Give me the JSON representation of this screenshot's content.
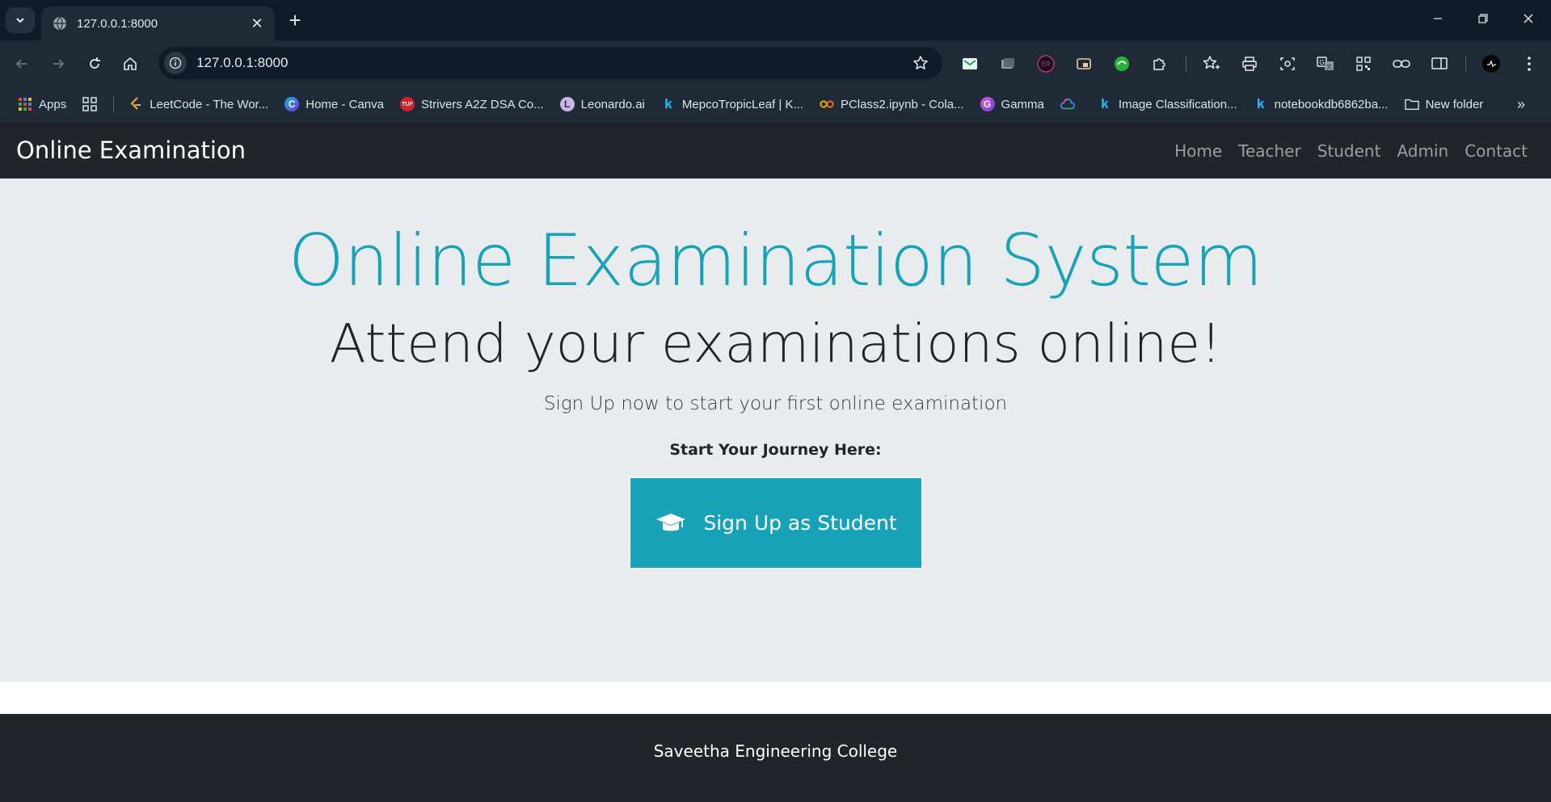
{
  "browser": {
    "tab_title": "127.0.0.1:8000",
    "tab_close": "✕",
    "new_tab": "+",
    "url": "127.0.0.1:8000",
    "bookmarks": [
      {
        "label": "Apps",
        "icon": "apps-grid-icon"
      },
      {
        "label": "LeetCode - The Wor...",
        "icon": "leetcode-icon"
      },
      {
        "label": "Home - Canva",
        "icon": "canva-icon"
      },
      {
        "label": "Strivers A2Z DSA Co...",
        "icon": "tuf-icon"
      },
      {
        "label": "Leonardo.ai",
        "icon": "leonardo-icon"
      },
      {
        "label": "MepcoTropicLeaf | K...",
        "icon": "kaggle-icon"
      },
      {
        "label": "PClass2.ipynb - Cola...",
        "icon": "colab-icon"
      },
      {
        "label": "Gamma",
        "icon": "gamma-icon"
      },
      {
        "label": "Image Classification...",
        "icon": "kaggle-icon"
      },
      {
        "label": "notebookdb6862ba...",
        "icon": "kaggle-icon"
      },
      {
        "label": "New folder",
        "icon": "folder-icon"
      }
    ],
    "bookmarks_more": "»"
  },
  "navbar": {
    "brand": "Online Examination",
    "links": [
      "Home",
      "Teacher",
      "Student",
      "Admin",
      "Contact"
    ]
  },
  "hero": {
    "title": "Online Examination System",
    "subtitle": "Attend your examinations online!",
    "lead": "Sign Up now to start your first online examination",
    "journey": "Start Your Journey Here:",
    "signup_button": "Sign Up as Student"
  },
  "footer": {
    "text": "Saveetha Engineering College"
  },
  "colors": {
    "accent": "#17a2b8",
    "navbar_bg": "#212529",
    "jumbotron_bg": "#e9ecef",
    "chrome_dark": "#0f1b29",
    "chrome_toolbar": "#1f2a37"
  }
}
